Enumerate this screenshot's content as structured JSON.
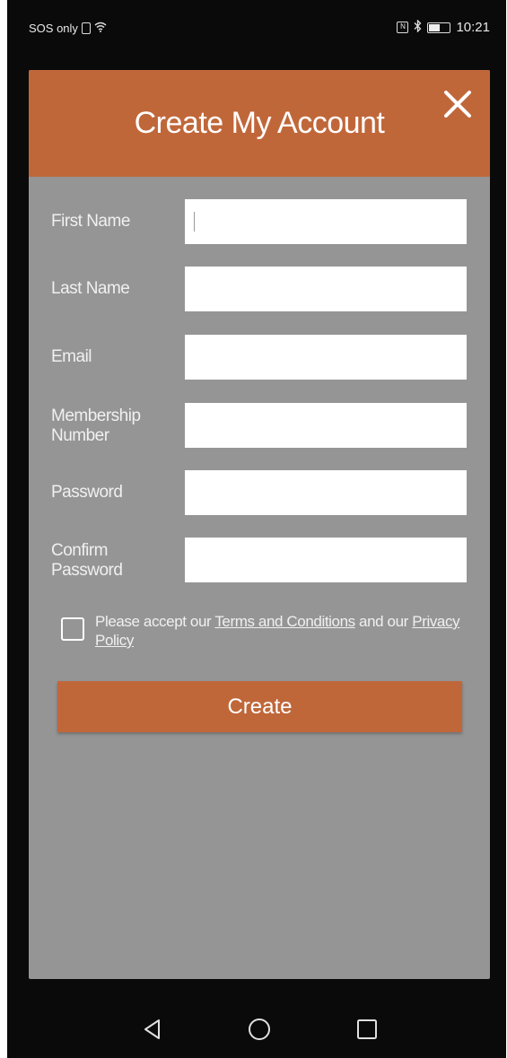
{
  "status_bar": {
    "carrier": "SOS only",
    "time": "10:21",
    "icons": [
      "sim-icon",
      "wifi-icon",
      "nfc-icon",
      "bluetooth-icon",
      "battery-icon"
    ]
  },
  "dialog": {
    "title": "Create My Account",
    "close_icon": "close-icon",
    "fields": [
      {
        "label": "First Name",
        "value": "",
        "placeholder": ""
      },
      {
        "label": "Last Name",
        "value": "",
        "placeholder": ""
      },
      {
        "label": "Email",
        "value": "",
        "placeholder": ""
      },
      {
        "label": "Membership Number",
        "value": "",
        "placeholder": ""
      },
      {
        "label": "Password",
        "value": "",
        "placeholder": ""
      },
      {
        "label": "Confirm Password",
        "value": "",
        "placeholder": ""
      }
    ],
    "terms": {
      "prefix": "Please accept our ",
      "terms_link": "Terms and Conditions",
      "middle": " and our ",
      "privacy_link": "Privacy Policy"
    },
    "create_label": "Create"
  },
  "nav_bar": {
    "icons": [
      "back-icon",
      "home-icon",
      "recents-icon"
    ]
  },
  "colors": {
    "accent": "#c0673a",
    "panel": "#959595",
    "background": "#0a0a0a"
  }
}
